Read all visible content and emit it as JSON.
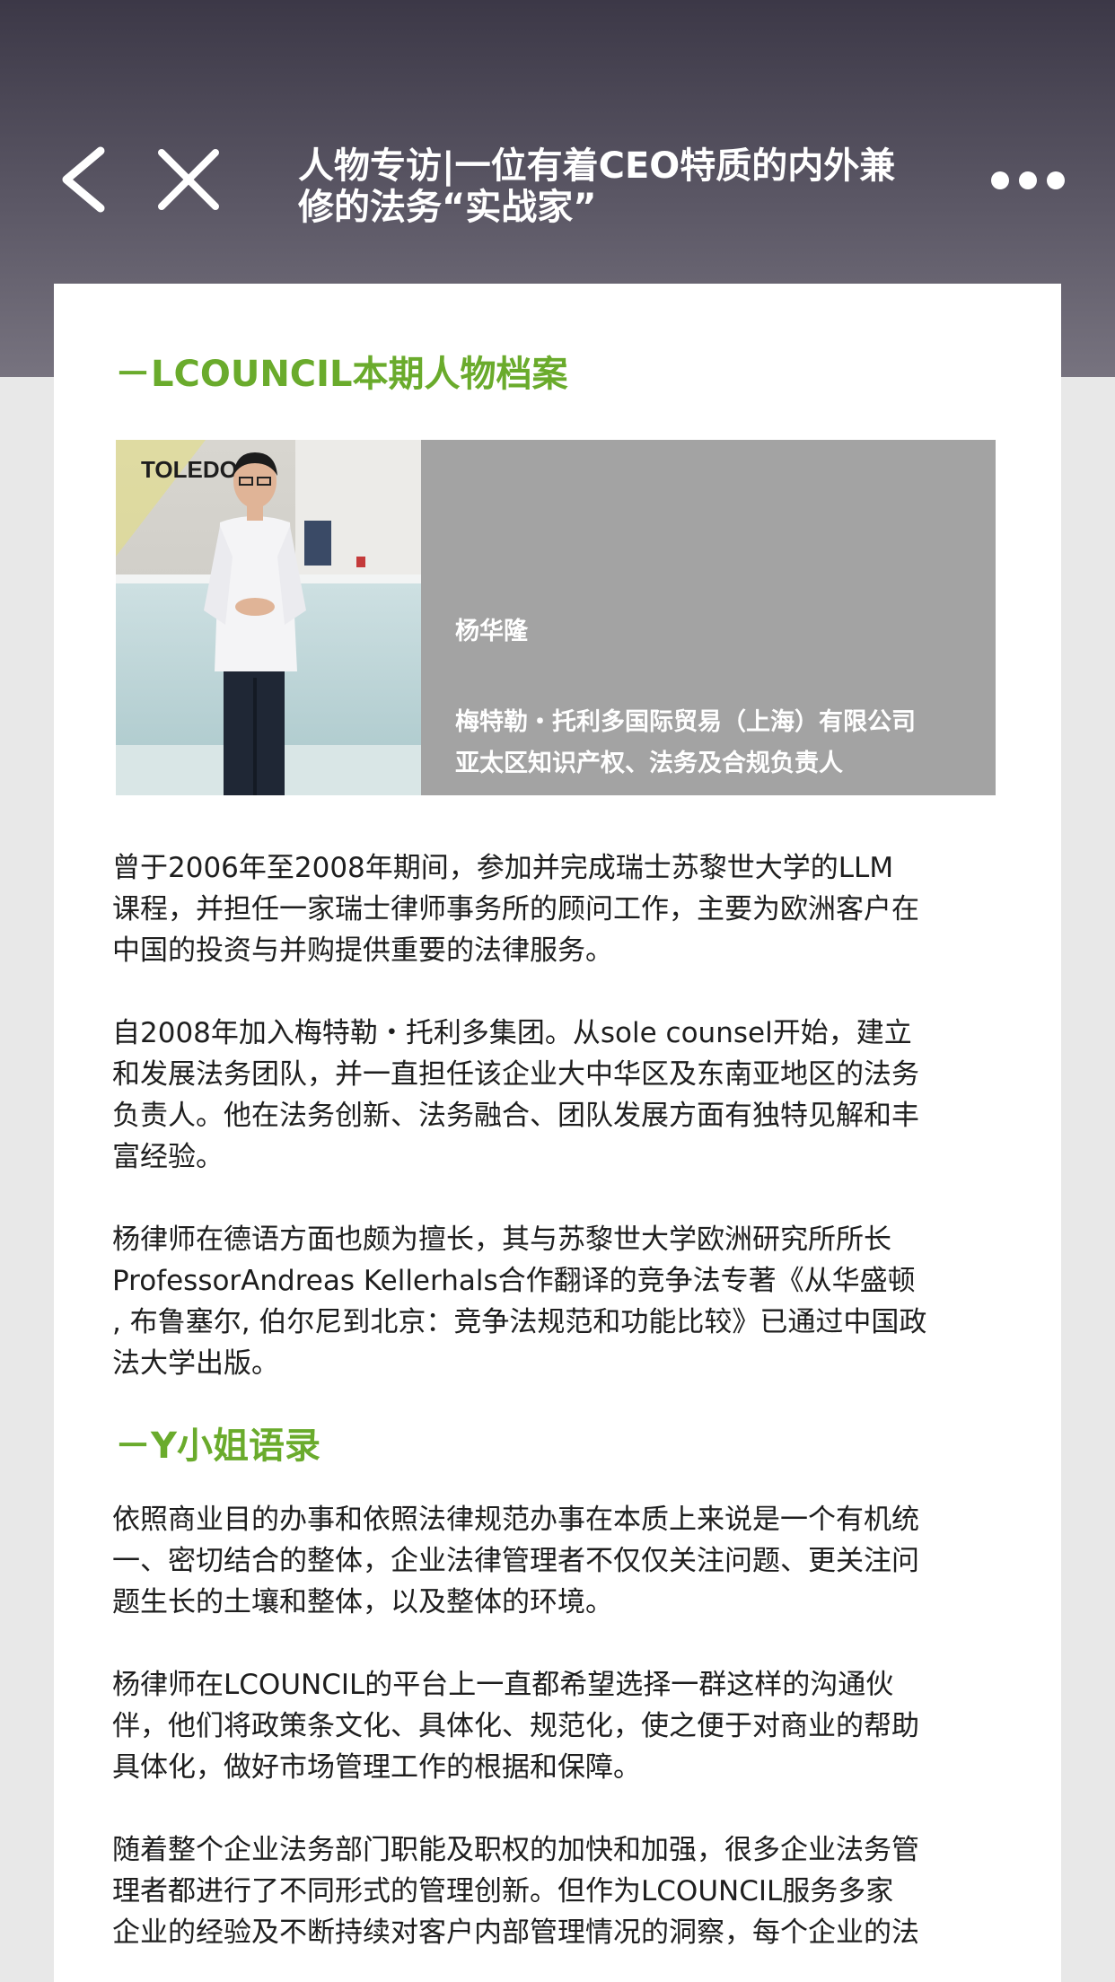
{
  "header": {
    "title": "人物专访|一位有着CEO特质的内外兼\n修的法务“实战家”",
    "back_icon": "chevron-left-icon",
    "close_icon": "close-icon",
    "more_icon": "more-dots-icon"
  },
  "profile_section": {
    "title": "－LCOUNCIL本期人物档案",
    "photo_sign": "TOLEDO",
    "name": "杨华隆",
    "company": "梅特勒・托利多国际贸易（上海）有限公司",
    "position": "亚太区知识产权、法务及合规负责人"
  },
  "bio_paragraphs": [
    "曾于2006年至2008年期间，参加并完成瑞士苏黎世大学的LLM\n课程，并担任一家瑞士律师事务所的顾问工作，主要为欧洲客户在\n中国的投资与并购提供重要的法律服务。",
    "自2008年加入梅特勒・托利多集团。从sole counsel开始，建立\n和发展法务团队，并一直担任该企业大中华区及东南亚地区的法务\n负责人。他在法务创新、法务融合、团队发展方面有独特见解和丰\n富经验。",
    "杨律师在德语方面也颇为擅长，其与苏黎世大学欧洲研究所所长\nProfessorAndreas Kellerhals合作翻译的竞争法专著《从华盛顿\n, 布鲁塞尔, 伯尔尼到北京：竞争法规范和功能比较》已通过中国政\n法大学出版。"
  ],
  "quote_section": {
    "title": "－Y小姐语录",
    "paragraphs": [
      "依照商业目的办事和依照法律规范办事在本质上来说是一个有机统\n一、密切结合的整体，企业法律管理者不仅仅关注问题、更关注问\n题生长的土壤和整体，以及整体的环境。",
      "杨律师在LCOUNCIL的平台上一直都希望选择一群这样的沟通伙\n伴，他们将政策条文化、具体化、规范化，使之便于对商业的帮助\n具体化，做好市场管理工作的根据和保障。",
      "随着整个企业法务部门职能及职权的加快和加强，很多企业法务管\n理者都进行了不同形式的管理创新。但作为LCOUNCIL服务多家\n企业的经验及不断持续对客户内部管理情况的洞察，每个企业的法"
    ]
  },
  "colors": {
    "accent_green": "#6aab2c",
    "header_bg": "#4a4654",
    "profile_bg": "#a3a3a3",
    "page_bg": "#e8e8e8"
  }
}
